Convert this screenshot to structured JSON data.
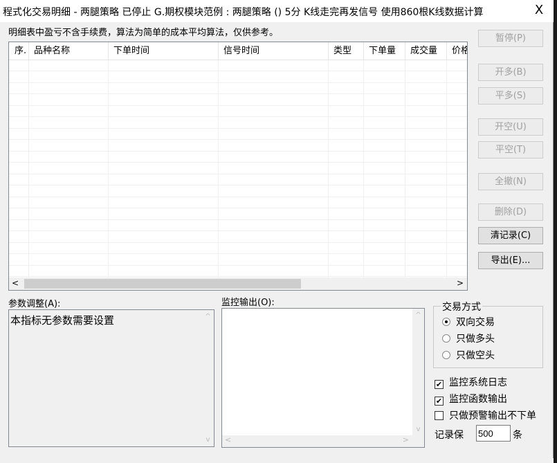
{
  "window": {
    "title": "程式化交易明细 - 两腿策略 已停止  G.期权模块范例 : 两腿策略 () 5分 K线走完再发信号 使用860根K线数据计算",
    "close": "X"
  },
  "notice": "明细表中盈亏不含手续费，算法为简单的成本平均算法，仅供参考。",
  "table": {
    "columns": [
      "序.",
      "品种名称",
      "下单时间",
      "信号时间",
      "类型",
      "下单量",
      "成交量",
      "价格"
    ]
  },
  "buttons": [
    {
      "label": "暂停(P)",
      "enabled": false
    },
    {
      "label": "开多(B)",
      "enabled": false
    },
    {
      "label": "平多(S)",
      "enabled": false
    },
    {
      "label": "开空(U)",
      "enabled": false
    },
    {
      "label": "平空(T)",
      "enabled": false
    },
    {
      "label": "全撤(N)",
      "enabled": false
    },
    {
      "label": "删除(D)",
      "enabled": false
    },
    {
      "label": "清记录(C)",
      "enabled": true
    },
    {
      "label": "导出(E)...",
      "enabled": true
    }
  ],
  "params": {
    "label": "参数调整(A):",
    "text": "本指标无参数需要设置"
  },
  "monitor": {
    "label": "监控输出(O):"
  },
  "trade_mode": {
    "label": "交易方式",
    "options": [
      "双向交易",
      "只做多头",
      "只做空头"
    ],
    "selected": 0
  },
  "checks": [
    {
      "label": "监控系统日志",
      "checked": true
    },
    {
      "label": "监控函数输出",
      "checked": true
    },
    {
      "label": "只做预警输出不下单",
      "checked": false
    }
  ],
  "records": {
    "label": "记录保",
    "value": "500",
    "unit": "条"
  }
}
